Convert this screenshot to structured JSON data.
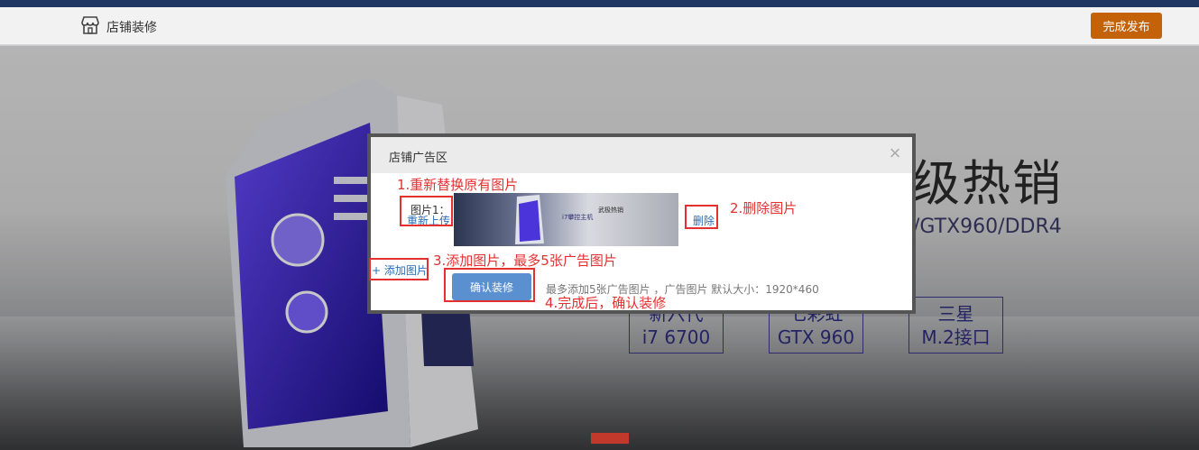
{
  "header": {
    "title": "店铺装修",
    "publish_label": "完成发布"
  },
  "banner": {
    "headline": "级热销",
    "subline": "/GTX960/DDR4",
    "features": [
      {
        "line1": "新六代",
        "line2": "i7 6700"
      },
      {
        "line1": "七彩虹",
        "line2": "GTX 960"
      },
      {
        "line1": "三星",
        "line2": "M.2接口"
      }
    ],
    "thumb_text1": "i7攀控主机",
    "thumb_text2": "武极热销"
  },
  "modal": {
    "title": "店铺广告区",
    "close": "×",
    "image_label": "图片1：",
    "reupload_label": "重新上传",
    "delete_label": "删除",
    "add_label": "+ 添加图片",
    "confirm_label": "确认装修",
    "hint": "最多添加5张广告图片 ，广告图片 默认大小：1920*460"
  },
  "annotations": {
    "a1": "1.重新替换原有图片",
    "a2": "2.删除图片",
    "a3": "3.添加图片，最多5张广告图片",
    "a4": "4.完成后，确认装修"
  },
  "colors": {
    "accent": "#c4620a",
    "topbar": "#1f3663",
    "annotation": "#e53030",
    "link": "#2a6db5",
    "confirm": "#5a8fd0"
  }
}
